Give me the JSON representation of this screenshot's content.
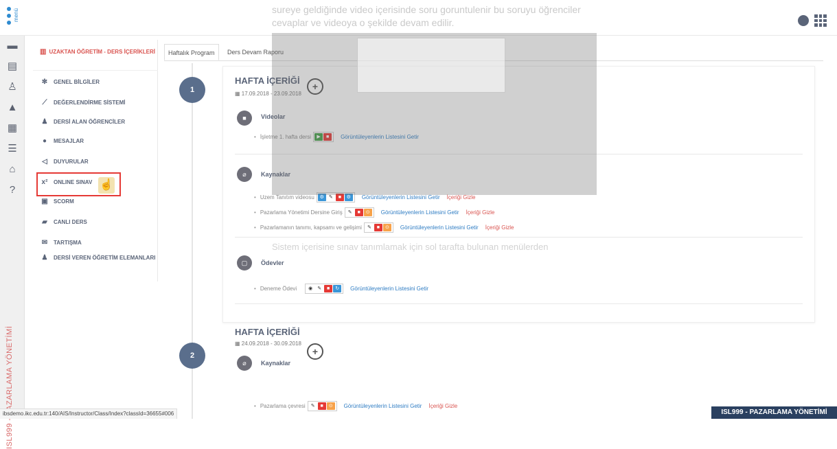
{
  "top": {
    "menu_label": "menü",
    "caption_line1": "sureye geldiğinde video içerisinde soru goruntulenir bu soruyu öğrenciler",
    "caption_line2": "cevaplar ve videoya o şekilde devam edilir."
  },
  "iconbar": {
    "vertical_label": "ISL999 - PAZARLAMA YÖNETİMİ"
  },
  "leftnav": {
    "header": "UZAKTAN ÖĞRETİM - DERS İÇERİKLERİ",
    "items": [
      {
        "label": "GENEL BİLGİLER",
        "icon": "gear-icon"
      },
      {
        "label": "DEĞERLENDİRME SİSTEMİ",
        "icon": "chart-icon"
      },
      {
        "label": "DERSİ ALAN ÖĞRENCİLER",
        "icon": "users-icon"
      },
      {
        "label": "MESAJLAR",
        "icon": "chat-icon"
      },
      {
        "label": "DUYURULAR",
        "icon": "megaphone-icon"
      },
      {
        "label": "ONLINE SINAV",
        "icon": "x2-icon"
      },
      {
        "label": "SCORM",
        "icon": "file-icon"
      },
      {
        "label": "CANLI DERS",
        "icon": "video-icon"
      },
      {
        "label": "TARTIŞMA",
        "icon": "envelope-icon"
      },
      {
        "label": "DERSİ VEREN ÖĞRETİM ELEMANLARI",
        "icon": "teachers-icon"
      }
    ]
  },
  "tabs": [
    "Haftalık Program",
    "Ders Devam Raporu"
  ],
  "week1": {
    "number": "1",
    "title": "HAFTA İÇERİĞİ",
    "date": "17.09.2018 - 23.09.2018",
    "videos_title": "Videolar",
    "video_item": "İşletme 1. hafta dersi",
    "video_link": "Görüntüleyenlerin Listesini Getir",
    "resources_title": "Kaynaklar",
    "res1": "Uzem Tanıtım videosu",
    "res2": "Pazarlama Yönetimi Dersine Giriş",
    "res3": "Pazarlamanın tanımı, kapsamı ve gelişimi",
    "link_list": "Görüntüleyenlerin Listesini Getir",
    "link_hide": "İçeriği Gizle",
    "assign_title": "Ödevler",
    "assign1": "Deneme Ödevi"
  },
  "week2": {
    "number": "2",
    "title": "HAFTA İÇERİĞİ",
    "date": "24.09.2018 - 30.09.2018",
    "resources_title": "Kaynaklar",
    "res1": "Pazarlama çevresi"
  },
  "overlay_text": "Sistem içerisine sınav tanımlamak için sol tarafta bulunan menülerden",
  "status_url": "ibsdemo.ikc.edu.tr:140/AIS/Instructor/Class/Index?classId=36655#006",
  "course_badge": "ISL999 - PAZARLAMA YÖNETİMİ"
}
